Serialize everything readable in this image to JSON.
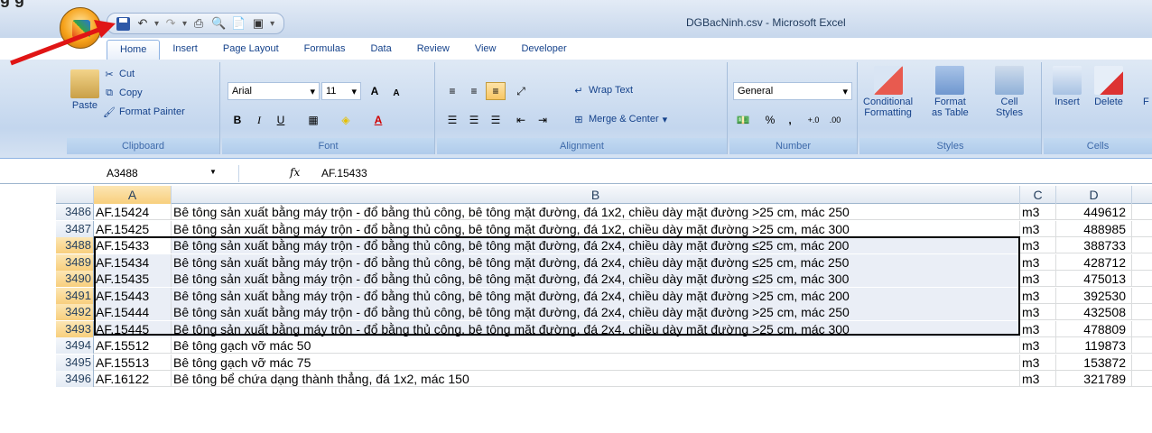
{
  "app": {
    "window_title": "DGBacNinh.csv - Microsoft Excel",
    "cropped_heading": "g g"
  },
  "ribbon": {
    "tabs": [
      "Home",
      "Insert",
      "Page Layout",
      "Formulas",
      "Data",
      "Review",
      "View",
      "Developer"
    ],
    "clipboard": {
      "paste": "Paste",
      "cut": "Cut",
      "copy": "Copy",
      "format_painter": "Format Painter",
      "label": "Clipboard"
    },
    "font": {
      "name": "Arial",
      "size": "11",
      "bold": "B",
      "italic": "I",
      "underline": "U",
      "grow": "A",
      "shrink": "A",
      "label": "Font"
    },
    "alignment": {
      "wrap_text": "Wrap Text",
      "merge_center": "Merge & Center",
      "label": "Alignment"
    },
    "number": {
      "format": "General",
      "percent": "%",
      "comma": ",",
      "label": "Number"
    },
    "styles": {
      "conditional": "Conditional",
      "conditional2": "Formatting",
      "format_as": "Format",
      "format_as2": "as Table",
      "cell": "Cell",
      "cell2": "Styles",
      "label": "Styles"
    },
    "cells": {
      "insert": "Insert",
      "delete": "Delete",
      "format_cut": "F",
      "label": "Cells"
    }
  },
  "formula_bar": {
    "name_box": "A3488",
    "fx": "fx",
    "value": "AF.15433"
  },
  "sheet": {
    "columns": [
      "A",
      "B",
      "C",
      "D"
    ],
    "rows": [
      {
        "num": "3486",
        "a": "AF.15424",
        "b": "Bê tông sản xuất bằng máy trộn - đổ bằng thủ công, bê tông mặt đường, đá 1x2, chiều dày mặt đường >25 cm, mác 250",
        "c": "m3",
        "d": "449612",
        "selected": false
      },
      {
        "num": "3487",
        "a": "AF.15425",
        "b": "Bê tông sản xuất bằng máy trộn - đổ bằng thủ công, bê tông mặt đường, đá 1x2, chiều dày mặt đường >25 cm, mác 300",
        "c": "m3",
        "d": "488985",
        "selected": false
      },
      {
        "num": "3488",
        "a": "AF.15433",
        "b": "Bê tông sản xuất bằng máy trộn - đổ bằng thủ công, bê tông mặt đường, đá 2x4, chiều dày mặt đường ≤25 cm, mác 200",
        "c": "m3",
        "d": "388733",
        "selected": true
      },
      {
        "num": "3489",
        "a": "AF.15434",
        "b": "Bê tông sản xuất bằng máy trộn - đổ bằng thủ công, bê tông mặt đường, đá 2x4, chiều dày mặt đường ≤25 cm, mác 250",
        "c": "m3",
        "d": "428712",
        "selected": true
      },
      {
        "num": "3490",
        "a": "AF.15435",
        "b": "Bê tông sản xuất bằng máy trộn - đổ bằng thủ công, bê tông mặt đường, đá 2x4, chiều dày mặt đường ≤25 cm, mác 300",
        "c": "m3",
        "d": "475013",
        "selected": true
      },
      {
        "num": "3491",
        "a": "AF.15443",
        "b": "Bê tông sản xuất bằng máy trộn - đổ bằng thủ công, bê tông mặt đường, đá 2x4, chiều dày mặt đường >25 cm, mác 200",
        "c": "m3",
        "d": "392530",
        "selected": true
      },
      {
        "num": "3492",
        "a": "AF.15444",
        "b": "Bê tông sản xuất bằng máy trộn - đổ bằng thủ công, bê tông mặt đường, đá 2x4, chiều dày mặt đường >25 cm, mác 250",
        "c": "m3",
        "d": "432508",
        "selected": true
      },
      {
        "num": "3493",
        "a": "AF.15445",
        "b": "Bê tông sản xuất bằng máy trộn - đổ bằng thủ công, bê tông mặt đường, đá 2x4, chiều dày mặt đường >25 cm, mác 300",
        "c": "m3",
        "d": "478809",
        "selected": true
      },
      {
        "num": "3494",
        "a": "AF.15512",
        "b": "Bê tông gạch vỡ mác 50",
        "c": "m3",
        "d": "119873",
        "selected": false
      },
      {
        "num": "3495",
        "a": "AF.15513",
        "b": "Bê tông gạch vỡ mác 75",
        "c": "m3",
        "d": "153872",
        "selected": false
      },
      {
        "num": "3496",
        "a": "AF.16122",
        "b": "Bê tông bể chứa dạng thành thẳng, đá 1x2, mác 150",
        "c": "m3",
        "d": "321789",
        "selected": false
      }
    ]
  },
  "colors": {
    "arrow": "#e01515",
    "selection_header": "#f8cf7d",
    "ribbon_bg": "#c3d6ee"
  }
}
